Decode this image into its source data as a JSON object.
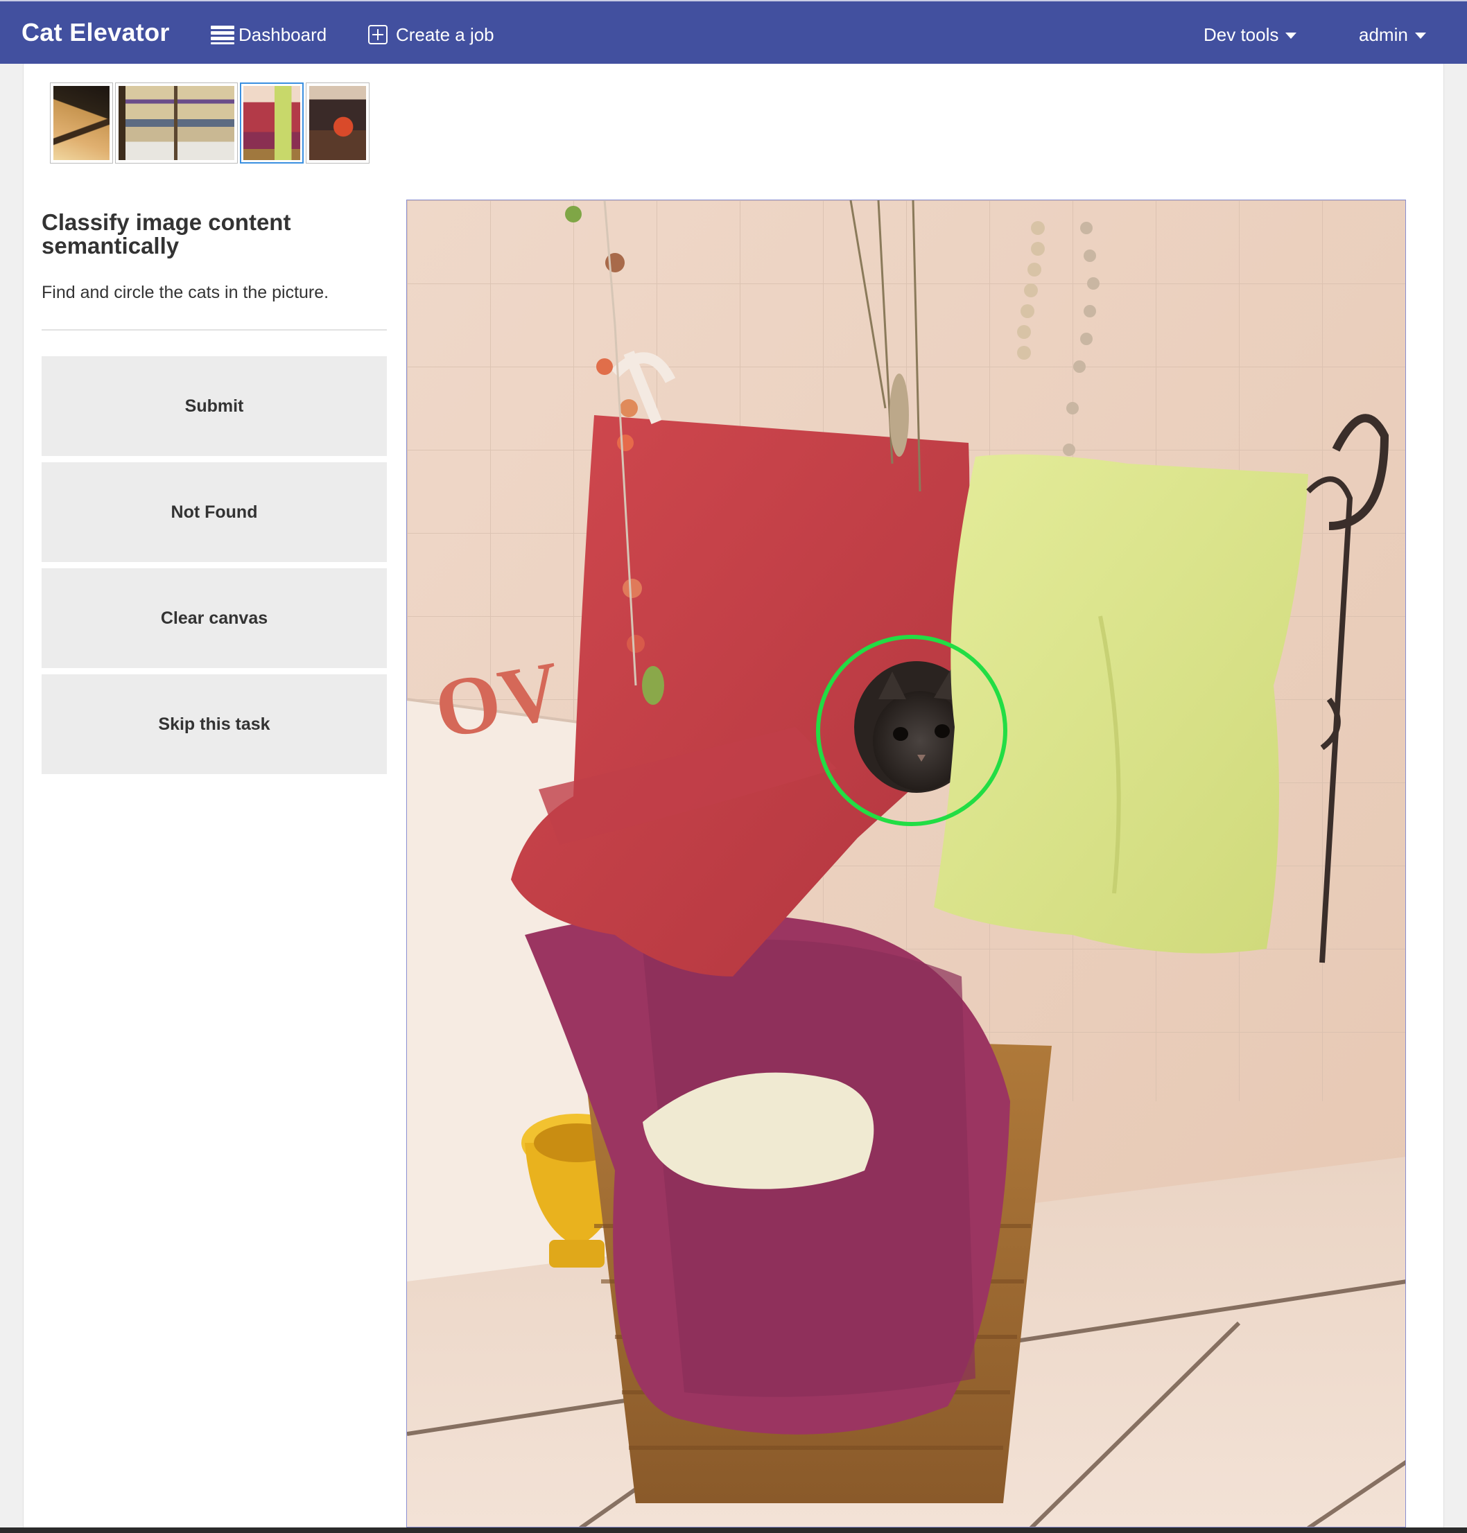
{
  "app": {
    "brand": "Cat Elevator"
  },
  "nav": {
    "dashboard": "Dashboard",
    "create_job": "Create a job",
    "dev_tools": "Dev tools",
    "user": "admin"
  },
  "thumbnails": {
    "count": 4,
    "selected_index": 2
  },
  "task": {
    "title": "Classify image content semantically",
    "description": "Find and circle the cats in the picture."
  },
  "actions": {
    "submit": "Submit",
    "not_found": "Not Found",
    "clear_canvas": "Clear canvas",
    "skip": "Skip this task"
  },
  "colors": {
    "navbar": "#42509f",
    "button_bg": "#ececec",
    "selection_circle": "#22dd44",
    "active_thumb_border": "#3a8fe0"
  },
  "icons": {
    "dashboard": "dashboard-list-icon",
    "create_job": "plus-square-icon",
    "dropdown": "caret-down-icon"
  }
}
